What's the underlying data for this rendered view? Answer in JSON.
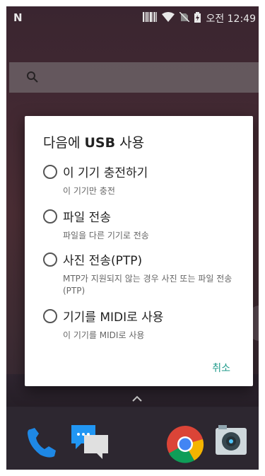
{
  "status_bar": {
    "time": "오전 12:49",
    "icons": [
      "notification-n-icon",
      "barcode-icon",
      "wifi-icon",
      "no-sim-icon",
      "battery-charging-icon"
    ]
  },
  "home": {
    "search_icon": "search-icon",
    "dock": [
      "phone-icon",
      "messaging-icon",
      "chrome-icon",
      "camera-icon"
    ]
  },
  "dialog": {
    "title_prefix": "다음에 ",
    "title_bold": "USB",
    "title_suffix": " 사용",
    "options": [
      {
        "label": "이 기기 충전하기",
        "sub": "이 기기만 충전"
      },
      {
        "label": "파일 전송",
        "sub": "파일을 다른 기기로 전송"
      },
      {
        "label": "사진 전송(PTP)",
        "sub": "MTP가 지원되지 않는 경우 사진 또는 파일 전송(PTP)"
      },
      {
        "label": "기기를 MIDI로 사용",
        "sub": "이 기기를 MIDI로 사용"
      }
    ],
    "cancel": "취소"
  }
}
